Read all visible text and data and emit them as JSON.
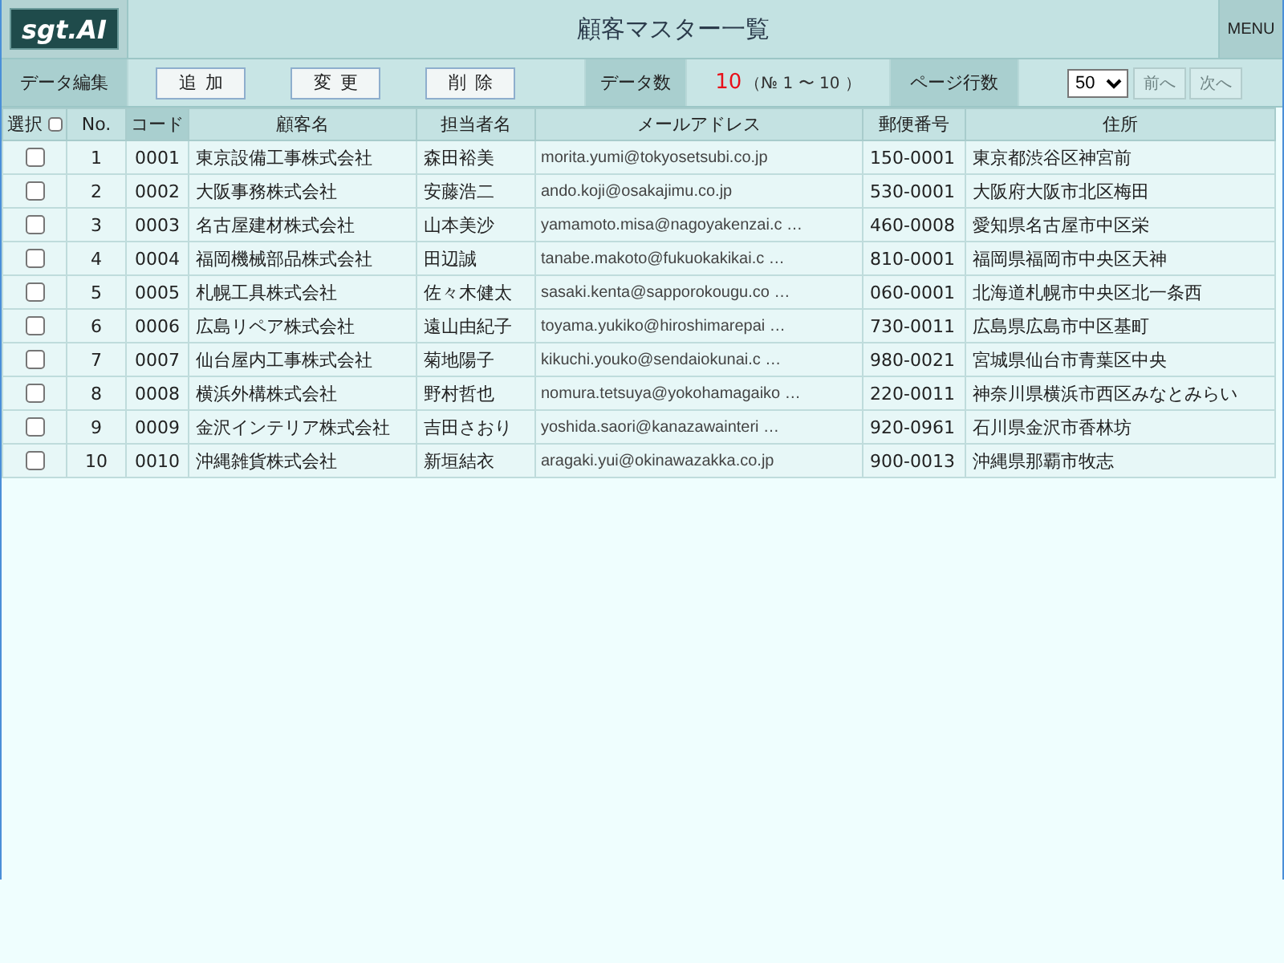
{
  "header": {
    "logo": "sgt.AI",
    "title": "顧客マスター一覧",
    "menu": "MENU"
  },
  "toolbar": {
    "edit_label": "データ編集",
    "buttons": [
      "追加",
      "変更",
      "削除"
    ],
    "count_label": "データ数",
    "count": "10",
    "range": "（№ 1 〜 10 ）",
    "rows_per_page_label": "ページ行数",
    "rows_per_page": "50",
    "pager": [
      {
        "label": "前へ",
        "disabled": true
      },
      {
        "label": "次へ",
        "disabled": true
      }
    ]
  },
  "table": {
    "columns": [
      {
        "label": "選択",
        "kind": "checkbox",
        "checked": false,
        "selected": false
      },
      {
        "label": "No.",
        "kind": "text",
        "selected": false
      },
      {
        "label": "コード",
        "kind": "text",
        "selected": true
      },
      {
        "label": "顧客名",
        "kind": "text",
        "selected": false
      },
      {
        "label": "担当者名",
        "kind": "text",
        "selected": false
      },
      {
        "label": "メールアドレス",
        "kind": "text",
        "selected": false
      },
      {
        "label": "郵便番号",
        "kind": "text",
        "selected": false
      },
      {
        "label": "住所",
        "kind": "text",
        "selected": false
      }
    ],
    "rows": [
      {
        "checked": false,
        "no": "1",
        "code": "0001",
        "customer": "東京設備工事株式会社",
        "contact": "森田裕美",
        "email": "morita.yumi@tokyosetsubi.co.jp",
        "postal": "150-0001",
        "address": "東京都渋谷区神宮前"
      },
      {
        "checked": false,
        "no": "2",
        "code": "0002",
        "customer": "大阪事務株式会社",
        "contact": "安藤浩二",
        "email": "ando.koji@osakajimu.co.jp",
        "postal": "530-0001",
        "address": "大阪府大阪市北区梅田"
      },
      {
        "checked": false,
        "no": "3",
        "code": "0003",
        "customer": "名古屋建材株式会社",
        "contact": "山本美沙",
        "email": "yamamoto.misa@nagoyakenzai.c …",
        "postal": "460-0008",
        "address": "愛知県名古屋市中区栄"
      },
      {
        "checked": false,
        "no": "4",
        "code": "0004",
        "customer": "福岡機械部品株式会社",
        "contact": "田辺誠",
        "email": "tanabe.makoto@fukuokakikai.c …",
        "postal": "810-0001",
        "address": "福岡県福岡市中央区天神"
      },
      {
        "checked": false,
        "no": "5",
        "code": "0005",
        "customer": "札幌工具株式会社",
        "contact": "佐々木健太",
        "email": "sasaki.kenta@sapporokougu.co …",
        "postal": "060-0001",
        "address": "北海道札幌市中央区北一条西"
      },
      {
        "checked": false,
        "no": "6",
        "code": "0006",
        "customer": "広島リペア株式会社",
        "contact": "遠山由紀子",
        "email": "toyama.yukiko@hiroshimarepai …",
        "postal": "730-0011",
        "address": "広島県広島市中区基町"
      },
      {
        "checked": false,
        "no": "7",
        "code": "0007",
        "customer": "仙台屋内工事株式会社",
        "contact": "菊地陽子",
        "email": "kikuchi.youko@sendaiokunai.c …",
        "postal": "980-0021",
        "address": "宮城県仙台市青葉区中央"
      },
      {
        "checked": false,
        "no": "8",
        "code": "0008",
        "customer": "横浜外構株式会社",
        "contact": "野村哲也",
        "email": "nomura.tetsuya@yokohamagaiko …",
        "postal": "220-0011",
        "address": "神奈川県横浜市西区みなとみらい"
      },
      {
        "checked": false,
        "no": "9",
        "code": "0009",
        "customer": "金沢インテリア株式会社",
        "contact": "吉田さおり",
        "email": "yoshida.saori@kanazawainteri …",
        "postal": "920-0961",
        "address": "石川県金沢市香林坊"
      },
      {
        "checked": false,
        "no": "10",
        "code": "0010",
        "customer": "沖縄雑貨株式会社",
        "contact": "新垣結衣",
        "email": "aragaki.yui@okinawazakka.co.jp",
        "postal": "900-0013",
        "address": "沖縄県那覇市牧志"
      }
    ]
  }
}
